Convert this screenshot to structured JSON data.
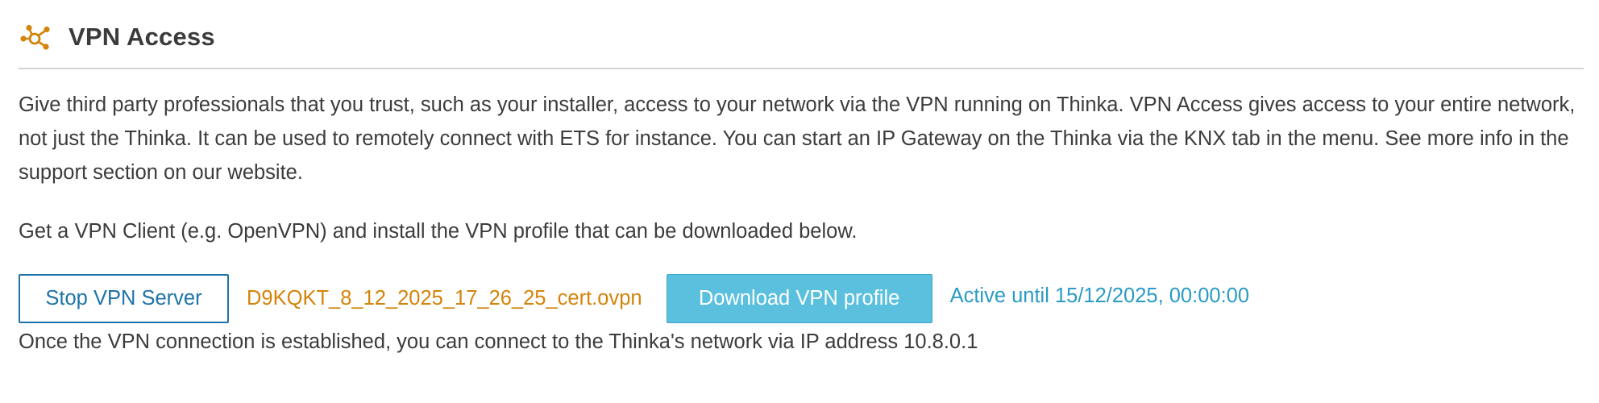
{
  "section": {
    "title": "VPN Access",
    "icon": "network-nodes-icon",
    "icon_color": "#d4840a"
  },
  "description": "Give third party professionals that you trust, such as your installer, access to your network via the VPN running on Thinka. VPN Access gives access to your entire network, not just the Thinka. It can be used to remotely connect with ETS for instance. You can start an IP Gateway on the Thinka via the KNX tab in the menu. See more info in the support section on our website.",
  "instruction": "Get a VPN Client (e.g. OpenVPN) and install the VPN profile that can be downloaded below.",
  "actions": {
    "stop_button_label": "Stop VPN Server",
    "cert_filename": "D9KQKT_8_12_2025_17_26_25_cert.ovpn",
    "download_button_label": "Download VPN profile",
    "active_until": "Active until 15/12/2025, 00:00:00"
  },
  "ip_note": "Once the VPN connection is established, you can connect to the Thinka's network via IP address 10.8.0.1",
  "colors": {
    "accent_orange": "#d4840a",
    "primary_blue": "#1e73a8",
    "info_button": "#5bc0de",
    "info_text": "#2a9bc4"
  }
}
